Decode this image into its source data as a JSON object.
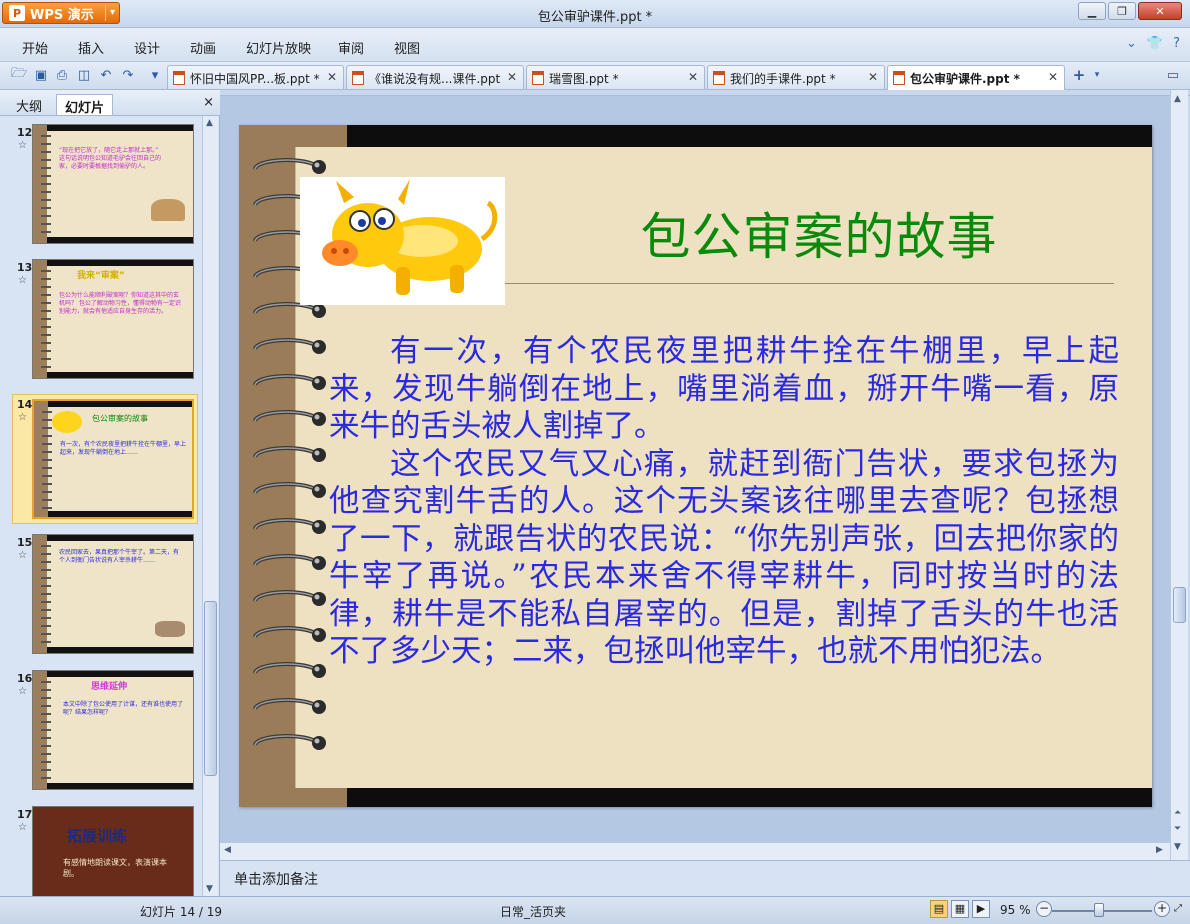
{
  "window": {
    "app_button": "WPS 演示",
    "title": "包公审驴课件.ppt *"
  },
  "menu": [
    "开始",
    "插入",
    "设计",
    "动画",
    "幻灯片放映",
    "审阅",
    "视图"
  ],
  "tabs": [
    {
      "label": "怀旧中国风PP...板.ppt *",
      "active": false
    },
    {
      "label": "《谁说没有规...课件.ppt",
      "active": false
    },
    {
      "label": "瑞雪图.ppt *",
      "active": false
    },
    {
      "label": "我们的手课件.ppt *",
      "active": false
    },
    {
      "label": "包公审驴课件.ppt *",
      "active": true
    }
  ],
  "left_panel": {
    "tab_outline": "大纲",
    "tab_slides": "幻灯片",
    "close": "×",
    "slides": [
      {
        "num": "12",
        "text": "“现在把它放了，随它走上那就上那。”\n这句话说明包公知道毛驴会往回自己的家，必要时要根据找到偷驴的人。",
        "selected": false
      },
      {
        "num": "13",
        "title": "我来“审案”",
        "text": "包公为什么能顺利破案呢？你知道这其中的玄机吗？\n包公了解动物习性，懂得动物有一定识别能力，就会有他适应自身生存的活力。",
        "selected": false
      },
      {
        "num": "14",
        "title": "包公审案的故事",
        "text": "有一次，有个农民夜里把耕牛拴在牛棚里，早上起来，发现牛躺倒在地上……",
        "selected": true
      },
      {
        "num": "15",
        "text": "农民回家去，果真把那个牛宰了。第二天，有个人到衙门告状说有人宰杀耕牛……",
        "selected": false
      },
      {
        "num": "16",
        "title": "思维延伸",
        "text": "本文中除了包公使用了计谋，还有谁也使用了呢？结果怎样呢？",
        "selected": false
      },
      {
        "num": "17",
        "title": "拓展训练",
        "text": "有感情地朗读课文，表演课本剧。",
        "selected": false
      }
    ]
  },
  "slide": {
    "title": "包公审案的故事",
    "paragraphs": [
      "有一次，有个农民夜里把耕牛拴在牛棚里，早上起来，发现牛躺倒在地上，嘴里淌着血，掰开牛嘴一看，原来牛的舌头被人割掉了。",
      "这个农民又气又心痛，就赶到衙门告状，要求包拯为他查究割牛舌的人。这个无头案该往哪里去查呢？包拯想了一下，就跟告状的农民说：“你先别声张，回去把你家的牛宰了再说。”农民本来舍不得宰耕牛，同时按当时的法律，耕牛是不能私自屠宰的。但是，割掉了舌头的牛也活不了多少天；二来，包拯叫他宰牛，也就不用怕犯法。"
    ]
  },
  "notes_placeholder": "单击添加备注",
  "status": {
    "slide_counter": "幻灯片 14 / 19",
    "template": "日常_活页夹",
    "zoom": "95 %"
  },
  "colors": {
    "title_green": "#0a8a0a",
    "body_blue": "#2a2ae2",
    "slide_bg": "#eee1c2",
    "spine_brown": "#9b7c59"
  }
}
